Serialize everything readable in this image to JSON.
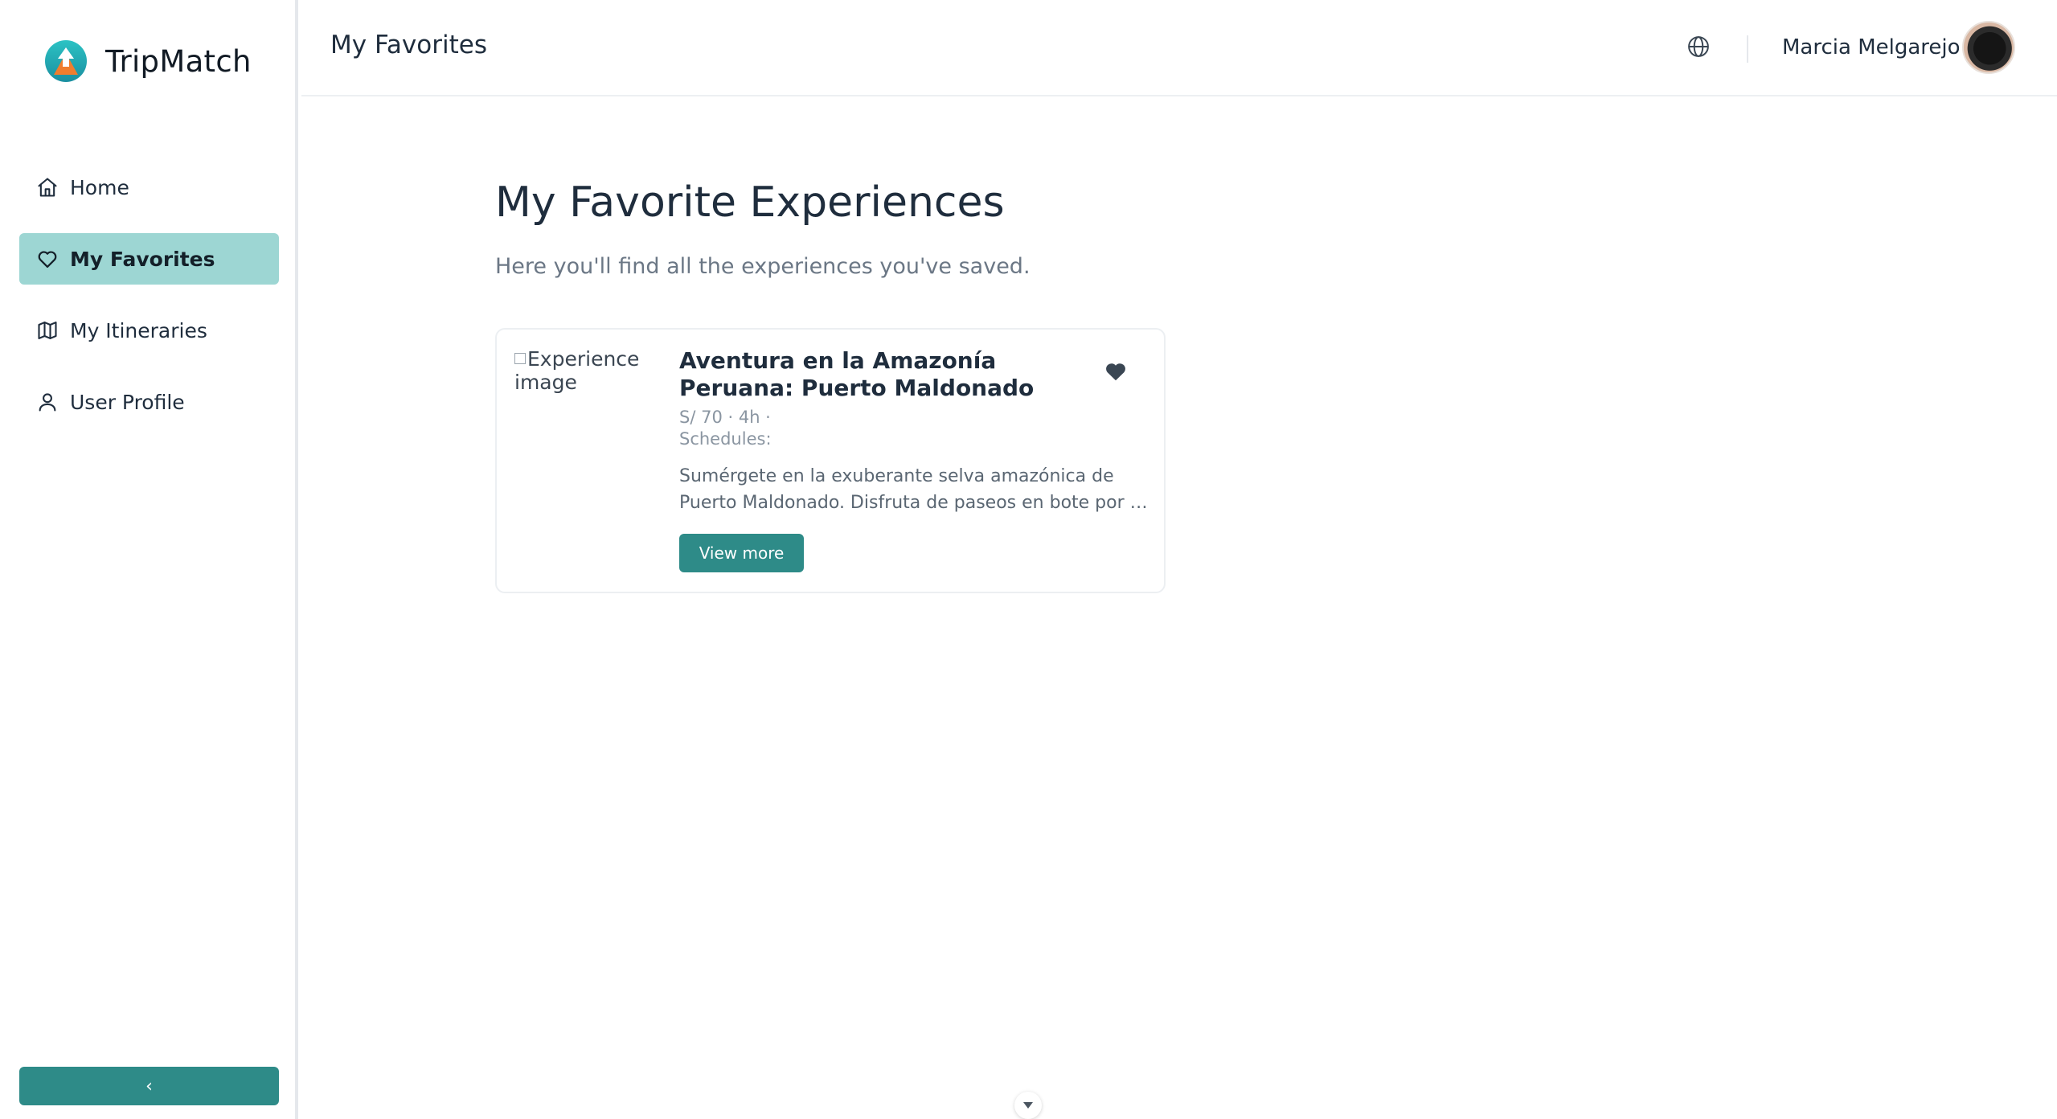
{
  "brand": {
    "name": "TripMatch",
    "logo_icon": "tripmatch-logo-icon"
  },
  "sidebar": {
    "items": [
      {
        "label": "Home",
        "icon": "home-icon",
        "active": false
      },
      {
        "label": "My Favorites",
        "icon": "heart-icon",
        "active": true
      },
      {
        "label": "My Itineraries",
        "icon": "map-icon",
        "active": false
      },
      {
        "label": "User Profile",
        "icon": "user-icon",
        "active": false
      }
    ],
    "collapse_label": "‹"
  },
  "header": {
    "title": "My Favorites",
    "language_icon": "globe-icon",
    "user_name": "Marcia Melgarejo"
  },
  "main": {
    "title": "My Favorite Experiences",
    "subtitle": "Here you'll find all the experiences you've saved.",
    "cards": [
      {
        "image_alt": "Experience image",
        "title": "Aventura en la Amazonía Peruana: Puerto Maldonado",
        "meta": "S/ 70 · 4h ·",
        "schedules_label": "Schedules:",
        "description_line1": "Sumérgete en la exuberante selva amazónica de",
        "description_line2": "Puerto Maldonado. Disfruta de paseos en bote por e...",
        "button_label": "View more",
        "favorited": true
      }
    ]
  },
  "colors": {
    "primary": "#2e8b88",
    "active_nav_bg": "#9dd6d3",
    "text": "#1f2d3d",
    "muted_text": "#6b7785"
  }
}
